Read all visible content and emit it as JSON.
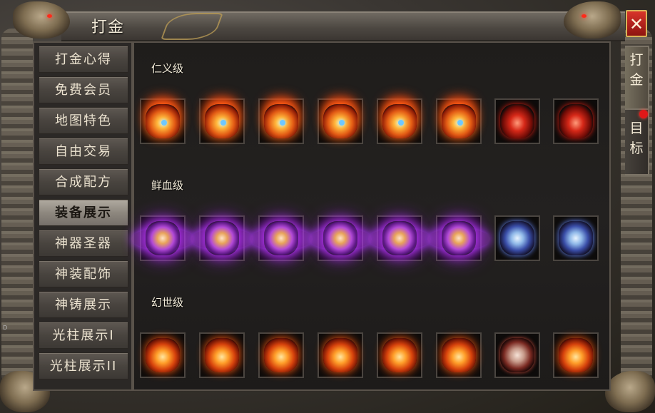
{
  "window": {
    "title": "打金",
    "close_label": "✕"
  },
  "side_tabs": [
    {
      "label": "打\n金",
      "active": true
    },
    {
      "label": "目\n标",
      "active": false,
      "has_notification": true
    }
  ],
  "nav": {
    "items": [
      {
        "label": "打金心得",
        "active": false
      },
      {
        "label": "免费会员",
        "active": false
      },
      {
        "label": "地图特色",
        "active": false
      },
      {
        "label": "自由交易",
        "active": false
      },
      {
        "label": "合成配方",
        "active": false
      },
      {
        "label": "装备展示",
        "active": true
      },
      {
        "label": "神器圣器",
        "active": false
      },
      {
        "label": "神装配饰",
        "active": false
      },
      {
        "label": "神铸展示",
        "active": false
      },
      {
        "label": "光柱展示I",
        "active": false
      },
      {
        "label": "光柱展示II",
        "active": false
      }
    ]
  },
  "content": {
    "tiers": [
      {
        "label": "仁义级",
        "item_icons": [
          "flame-helmet-icon",
          "flame-necklace-icon",
          "flame-bracelet-icon",
          "flame-ring-icon",
          "flame-belt-icon",
          "flame-boots-icon",
          "crimson-armor-icon",
          "crimson-weapon-icon"
        ]
      },
      {
        "label": "鲜血级",
        "item_icons": [
          "violet-helmet-icon",
          "violet-necklace-icon",
          "violet-bracelet-icon",
          "violet-ring-icon",
          "violet-belt-icon",
          "violet-boots-icon",
          "azure-armor-icon",
          "azure-weapon-icon"
        ]
      },
      {
        "label": "幻世级",
        "item_icons": [
          "ember-helmet-icon",
          "ember-necklace-icon",
          "ember-bracelet-icon",
          "ember-ring-icon",
          "ember-belt-icon",
          "ember-boots-icon",
          "ember-armor-icon",
          "ember-weapon-icon"
        ]
      }
    ]
  },
  "edge_mark": "D",
  "colors": {
    "accent_red": "#d8342a",
    "gold_border": "#d9b45a",
    "active_nav": "#b1aba1"
  }
}
